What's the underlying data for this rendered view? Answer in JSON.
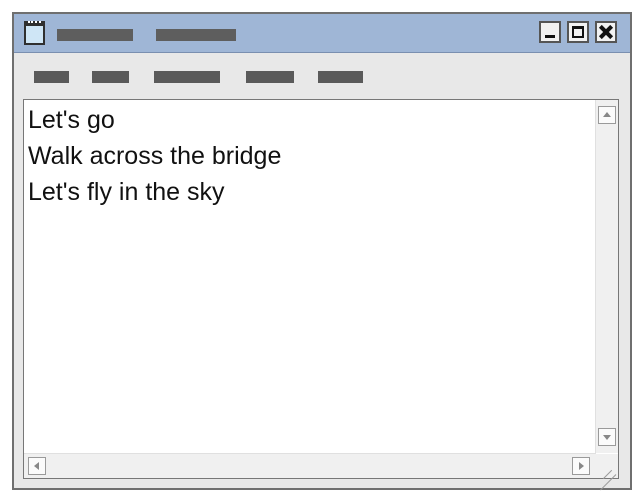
{
  "window": {
    "icon": "notepad-icon",
    "title_bar_color": "#9fb6d6",
    "controls": {
      "minimize_icon": "minimize-icon",
      "maximize_icon": "maximize-icon",
      "close_icon": "close-icon"
    }
  },
  "editor": {
    "lines": [
      "Let's go",
      "Walk across the bridge",
      "Let's fly in the sky"
    ]
  },
  "scrollbars": {
    "up_icon": "arrow-up-icon",
    "down_icon": "arrow-down-icon",
    "left_icon": "arrow-left-icon",
    "right_icon": "arrow-right-icon"
  }
}
